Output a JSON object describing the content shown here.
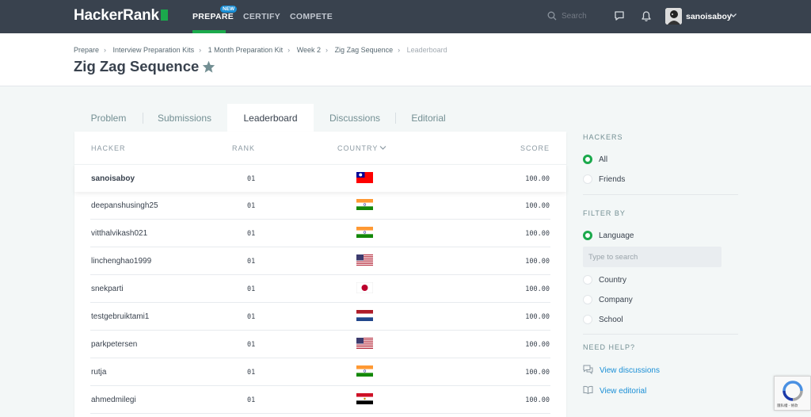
{
  "nav": {
    "logo": "HackerRank",
    "links": [
      "PREPARE",
      "CERTIFY",
      "COMPETE"
    ],
    "new_badge": "NEW",
    "search_placeholder": "Search",
    "username": "sanoisaboy"
  },
  "breadcrumb": [
    "Prepare",
    "Interview Preparation Kits",
    "1 Month Preparation Kit",
    "Week 2",
    "Zig Zag Sequence",
    "Leaderboard"
  ],
  "page_title": "Zig Zag Sequence",
  "tabs": [
    "Problem",
    "Submissions",
    "Leaderboard",
    "Discussions",
    "Editorial"
  ],
  "table": {
    "headers": {
      "hacker": "HACKER",
      "rank": "RANK",
      "country": "COUNTRY",
      "score": "SCORE"
    },
    "rows": [
      {
        "hacker": "sanoisaboy",
        "rank": "01",
        "country": "Taiwan",
        "score": "100.00"
      },
      {
        "hacker": "deepanshusingh25",
        "rank": "01",
        "country": "India",
        "score": "100.00"
      },
      {
        "hacker": "vitthalvikash021",
        "rank": "01",
        "country": "India",
        "score": "100.00"
      },
      {
        "hacker": "linchenghao1999",
        "rank": "01",
        "country": "United States",
        "score": "100.00"
      },
      {
        "hacker": "snekparti",
        "rank": "01",
        "country": "Japan",
        "score": "100.00"
      },
      {
        "hacker": "testgebruiktami1",
        "rank": "01",
        "country": "Netherlands",
        "score": "100.00"
      },
      {
        "hacker": "parkpetersen",
        "rank": "01",
        "country": "United States",
        "score": "100.00"
      },
      {
        "hacker": "rutja",
        "rank": "01",
        "country": "India",
        "score": "100.00"
      },
      {
        "hacker": "ahmedmilegi",
        "rank": "01",
        "country": "Egypt",
        "score": "100.00"
      }
    ]
  },
  "sidebar": {
    "hackers_heading": "HACKERS",
    "hackers_options": [
      "All",
      "Friends"
    ],
    "hackers_selected": "All",
    "filter_heading": "FILTER BY",
    "filter_options": [
      "Language",
      "Country",
      "Company",
      "School"
    ],
    "filter_selected": "Language",
    "filter_placeholder": "Type to search",
    "help_heading": "NEED HELP?",
    "help_links": [
      "View discussions",
      "View editorial"
    ]
  },
  "recaptcha_text": "隱私權 - 條款",
  "colors": {
    "nav_bg": "#39424e",
    "accent_green": "#1ba94c",
    "link_blue": "#1a8fd6",
    "page_bg": "#f3f7f7"
  },
  "icons": [
    "search-icon",
    "chat-icon",
    "bell-icon",
    "chevron-down-icon",
    "star-icon",
    "chat-bubble-icon",
    "book-icon",
    "recaptcha-icon"
  ]
}
